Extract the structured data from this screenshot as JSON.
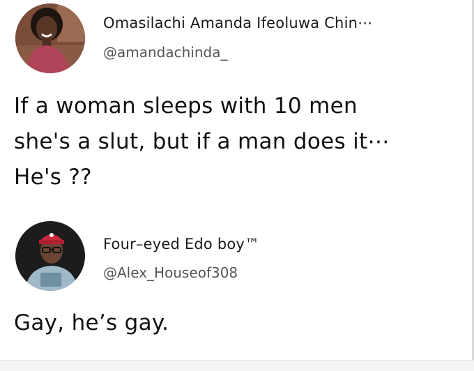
{
  "tweets": [
    {
      "display_name": "Omasilachi Amanda Ifeoluwa Chin⋯",
      "handle": "@amandachinda_",
      "avatar": "person-photo-icon",
      "text_lines": [
        "If a woman sleeps with 10 men",
        "she's a slut, but if a man does it⋯",
        "He's ??"
      ]
    },
    {
      "display_name": "Four–eyed Edo boy™",
      "handle": "@Alex_Houseof308",
      "avatar": "person-photo-icon",
      "text_lines": [
        "Gay, he’s gay."
      ]
    }
  ],
  "colors": {
    "background": "#ffffff",
    "text": "#111111",
    "handle": "#555555"
  }
}
